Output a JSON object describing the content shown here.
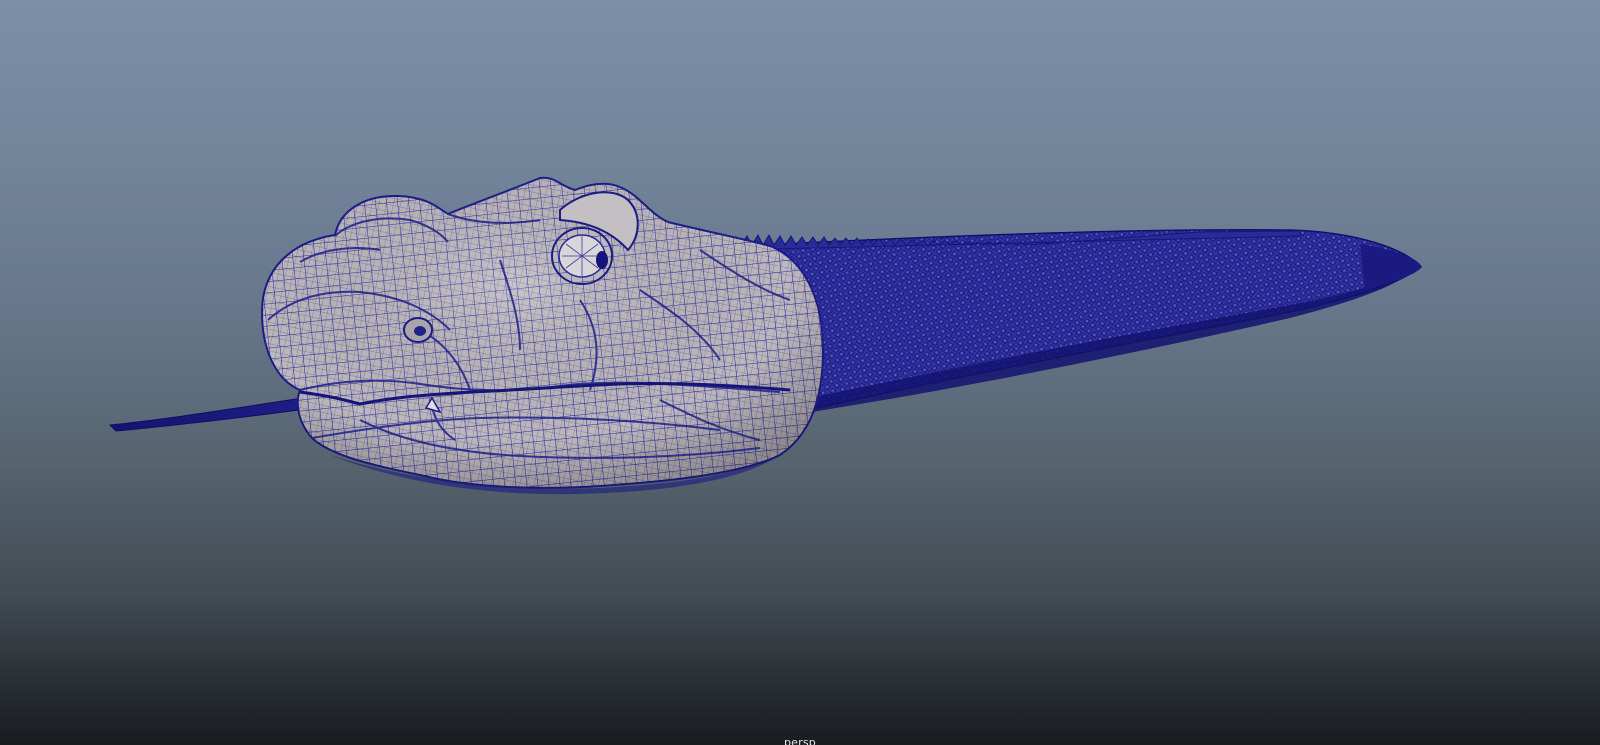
{
  "viewport": {
    "camera_name": "persp"
  },
  "scene": {
    "object": "snake-head-wireframe-model",
    "wire_color": "#1b1b8c",
    "surface_color": "#b9b4b8",
    "background_top": "#7d8fa6",
    "background_bottom": "#191c1f"
  }
}
